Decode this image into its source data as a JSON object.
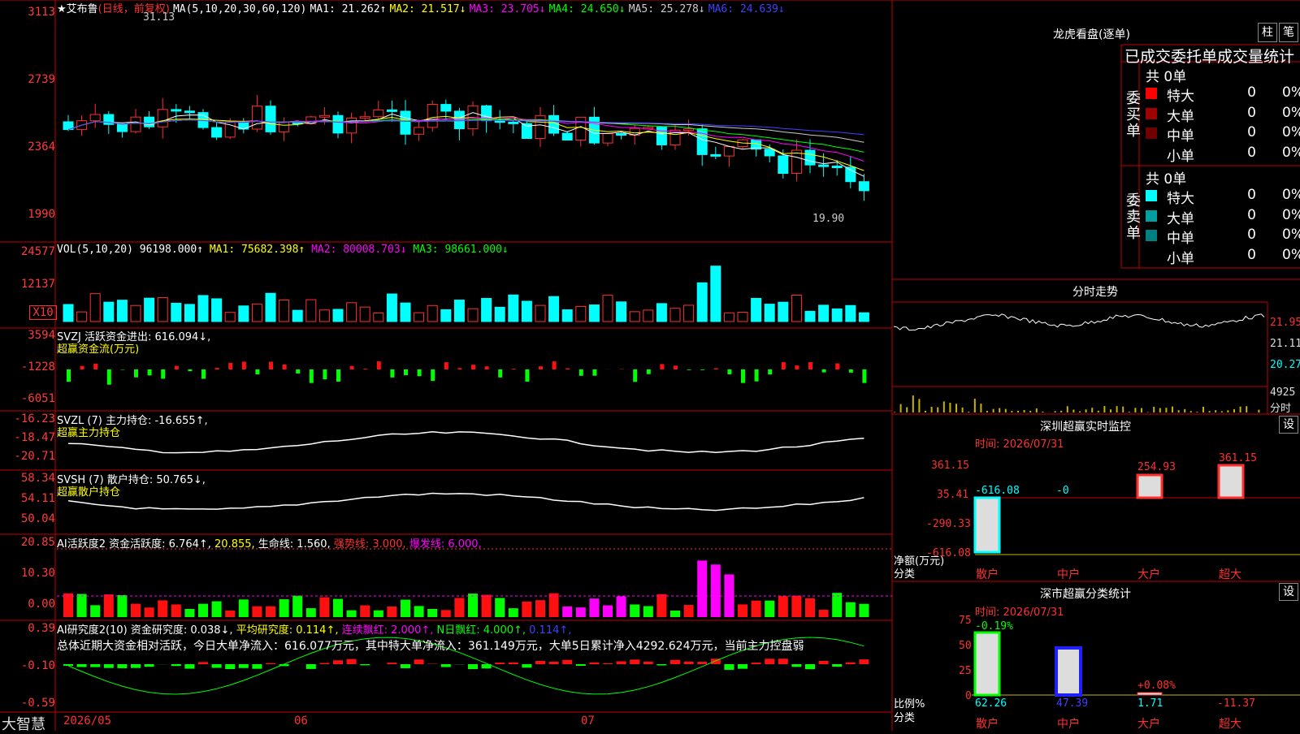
{
  "main": {
    "title_prefix": "★艾布鲁",
    "period": "(日线，前复权)",
    "ma_header": "MA(5,10,20,30,60,120)",
    "ma": [
      {
        "label": "MA1: 21.262↑",
        "color": "#ffffff"
      },
      {
        "label": "MA2: 21.517↓",
        "color": "#ffff00"
      },
      {
        "label": "MA3: 23.705↓",
        "color": "#ff00ff"
      },
      {
        "label": "MA4: 24.650↓",
        "color": "#00ff00"
      },
      {
        "label": "MA5: 25.278↓",
        "color": "#cccccc"
      },
      {
        "label": "MA6: 24.639↓",
        "color": "#4040ff"
      }
    ],
    "y_ticks": [
      "3113",
      "2739",
      "2364",
      "1990"
    ],
    "high_label": "31.13",
    "low_label": "19.90"
  },
  "vol": {
    "title": "VOL(5,10,20)",
    "value": "96198.000↑",
    "ma1": "MA1: 75682.398↑",
    "ma2": "MA2: 80008.703↓",
    "ma3": "MA3: 98661.000↓",
    "y_ticks": [
      "24577",
      "12137",
      "X10"
    ]
  },
  "svzj": {
    "title": "SVZJ  活跃资金进出: 616.094↓,",
    "subtitle": "超赢资金流(万元)",
    "y_ticks": [
      "3594",
      "-1228",
      "-6051"
    ]
  },
  "svzl": {
    "title": "SVZL (7) 主力持仓: -16.655↑,",
    "subtitle": "超赢主力持仓",
    "y_ticks": [
      "-16.23",
      "-18.47",
      "-20.71"
    ]
  },
  "svsh": {
    "title": "SVSH (7) 散户持仓: 50.765↓,",
    "subtitle": "超赢散户持仓",
    "y_ticks": [
      "58.34",
      "54.11",
      "50.04"
    ]
  },
  "ai_active": {
    "title_a": "AI活跃度2 资金活跃度: 6.764↑,",
    "title_b": "20.855,",
    "title_c": "生命线: 1.560,",
    "title_d": "强势线: 3.000,",
    "title_e": "爆发线: 6.000,",
    "y_ticks": [
      "20.85",
      "10.30",
      "0.00"
    ]
  },
  "ai_research": {
    "title_a": "AI研究度2(10) 资金研究度: 0.038↓,",
    "title_b": "平均研究度: 0.114↑,",
    "title_c": "连续飘红: 2.000↑,",
    "title_d": "N日飘红: 4.000↑,",
    "title_e": "0.114↑,",
    "summary": "总体近期大资金相对活跃，今日大单净流入：616.077万元，其中特大单净流入：361.149万元，大单5日累计净入4292.624万元，当前主力控盘弱",
    "y_ticks": [
      "0.39",
      "-0.10",
      "-0.59"
    ]
  },
  "bottom": {
    "brand": "大智慧",
    "dates": [
      "2026/05",
      "06",
      "07"
    ]
  },
  "right": {
    "header": "龙虎看盘(逐单)",
    "btn_zhu": "柱",
    "btn_bi": "笔",
    "stats_title": "已成交委托单成交量统计",
    "buy_label": "委买单",
    "sell_label": "委卖单",
    "buy_total": "共 0单",
    "sell_total": "共 0单",
    "buy_rows": [
      {
        "name": "特大",
        "count": "0",
        "pct": "0%",
        "color": "#ff0000"
      },
      {
        "name": "大单",
        "count": "0",
        "pct": "0%",
        "color": "#a00000"
      },
      {
        "name": "中单",
        "count": "0",
        "pct": "0%",
        "color": "#700000"
      },
      {
        "name": "小单",
        "count": "0",
        "pct": "0%",
        "color": ""
      }
    ],
    "sell_rows": [
      {
        "name": "特大",
        "count": "0",
        "pct": "0%",
        "color": "#00ffff"
      },
      {
        "name": "大单",
        "count": "0",
        "pct": "0%",
        "color": "#00a0a0"
      },
      {
        "name": "中单",
        "count": "0",
        "pct": "0%",
        "color": "#008080"
      },
      {
        "name": "小单",
        "count": "0",
        "pct": "0%",
        "color": ""
      }
    ],
    "intraday_title": "分时走势",
    "intraday_ticks": [
      "21.95",
      "21.11",
      "20.27",
      "4925",
      "分时"
    ],
    "sz_monitor_title": "深圳超赢实时监控",
    "sz_monitor_btn": "设",
    "sz_time": "时间: 2026/07/31",
    "sz_y": [
      "361.15",
      "35.41",
      "-290.33",
      "-616.08"
    ],
    "sz_bar_labels": [
      "-616.08",
      "-0",
      "254.93",
      "361.15"
    ],
    "sz_axis_title": "净额(万元)",
    "sz_axis_sub": "分类",
    "sz_cats": [
      "散户",
      "中户",
      "大户",
      "超大"
    ],
    "sh_title": "深市超赢分类统计",
    "sh_btn": "设",
    "sh_time": "时间: 2026/07/31",
    "sh_y": [
      "75",
      "50",
      "25",
      "0"
    ],
    "sh_top_labels": [
      "-0.19%",
      "",
      "+0.08%",
      ""
    ],
    "sh_bottom_values": [
      "62.26",
      "47.39",
      "1.71",
      "-11.37"
    ],
    "sh_axis_title": "比例%",
    "sh_axis_sub": "分类",
    "sh_cats": [
      "散户",
      "中户",
      "大户",
      "超大"
    ]
  }
}
